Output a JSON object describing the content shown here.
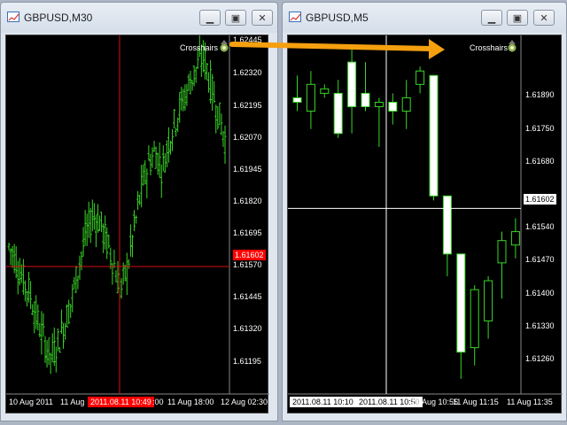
{
  "colors": {
    "candle_left": "#39d627",
    "candle_right": "#39d627",
    "crosshair_left": "#d61010",
    "crosshair_right": "#ffffff",
    "arrow": "#f5a00f",
    "price_tag_bg_left": "#ff0000",
    "price_tag_bg_right": "#ffffff"
  },
  "windows": [
    {
      "title": "GBPUSD,M30",
      "crosshairs_label": "Crosshairs",
      "price_labels": [
        "1.62445",
        "1.62320",
        "1.62195",
        "1.62070",
        "1.61945",
        "1.61820",
        "1.61695",
        "1.61570",
        "1.61445",
        "1.61320",
        "1.61195"
      ],
      "current_price": "1.61602",
      "time_labels": [
        "10 Aug 2011",
        "11 Aug",
        "11 Aug 18:00",
        "12 Aug 02:30"
      ],
      "time_tag": "2011.08.11 10:49",
      "time_tag_suffix": ":00"
    },
    {
      "title": "GBPUSD,M5",
      "crosshairs_label": "Crosshairs",
      "price_labels": [
        "1.61890",
        "1.61750",
        "1.61680",
        "1.61540",
        "1.61470",
        "1.61400",
        "1.61330",
        "1.61260"
      ],
      "current_price": "1.61602",
      "time_labels": [
        "10 Aug 10:55",
        "11 Aug 11:15",
        "11 Aug 11:35"
      ],
      "time_tag_a": "2011.08.11 10:10",
      "time_tag_b": "2011.08.11 10:50"
    }
  ],
  "chart_data": [
    {
      "type": "candlestick",
      "title": "GBPUSD,M30",
      "ylim": [
        1.6113,
        1.6248
      ],
      "current_price": 1.61602,
      "crosshair_time": "2011.08.11 10:49",
      "crosshair_price": 1.61602
    },
    {
      "type": "candlestick",
      "title": "GBPUSD,M5",
      "ylim": [
        1.612,
        1.6196
      ],
      "current_price": 1.61602,
      "crosshair_time": "2011.08.11 10:50",
      "crosshair_price": 1.61602,
      "candles": [
        {
          "o": 1.6185,
          "h": 1.619,
          "l": 1.6182,
          "c": 1.6184
        },
        {
          "o": 1.6182,
          "h": 1.6191,
          "l": 1.6178,
          "c": 1.6188
        },
        {
          "o": 1.6186,
          "h": 1.6188,
          "l": 1.6185,
          "c": 1.6187
        },
        {
          "o": 1.6186,
          "h": 1.6189,
          "l": 1.6176,
          "c": 1.6177
        },
        {
          "o": 1.6193,
          "h": 1.6196,
          "l": 1.6177,
          "c": 1.6183
        },
        {
          "o": 1.6186,
          "h": 1.6193,
          "l": 1.6182,
          "c": 1.6183
        },
        {
          "o": 1.6183,
          "h": 1.6185,
          "l": 1.6174,
          "c": 1.6184
        },
        {
          "o": 1.6184,
          "h": 1.6186,
          "l": 1.6179,
          "c": 1.6182
        },
        {
          "o": 1.6182,
          "h": 1.6189,
          "l": 1.6178,
          "c": 1.6185
        },
        {
          "o": 1.6188,
          "h": 1.6192,
          "l": 1.6186,
          "c": 1.6191
        },
        {
          "o": 1.619,
          "h": 1.619,
          "l": 1.6162,
          "c": 1.6163
        },
        {
          "o": 1.6163,
          "h": 1.6163,
          "l": 1.6145,
          "c": 1.615
        },
        {
          "o": 1.615,
          "h": 1.615,
          "l": 1.6122,
          "c": 1.6128
        },
        {
          "o": 1.6129,
          "h": 1.6143,
          "l": 1.6125,
          "c": 1.6142
        },
        {
          "o": 1.6135,
          "h": 1.6145,
          "l": 1.6131,
          "c": 1.6144
        },
        {
          "o": 1.6148,
          "h": 1.6155,
          "l": 1.614,
          "c": 1.6153
        },
        {
          "o": 1.6152,
          "h": 1.6158,
          "l": 1.6149,
          "c": 1.6155
        }
      ]
    }
  ]
}
